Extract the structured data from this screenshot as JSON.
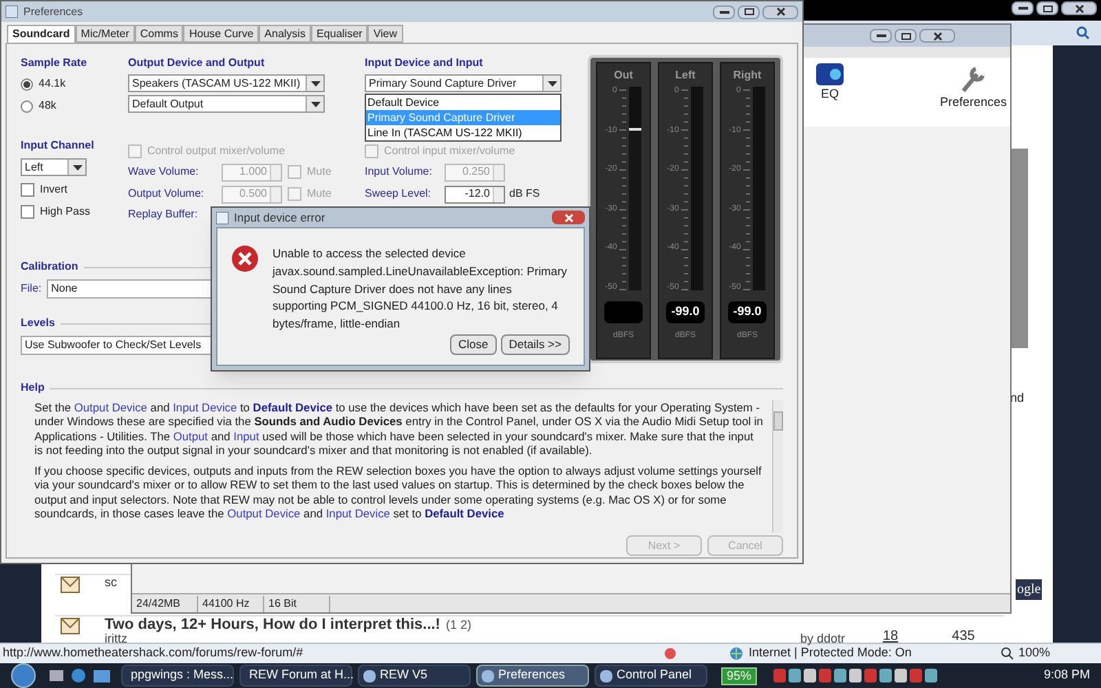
{
  "browser": {
    "forum_rows": [
      {
        "title": "sc"
      },
      {
        "title": "Two days, 12+ Hours, How do I interpret this...!",
        "pages": "(1 2)",
        "author": "irittz",
        "last_post": "by ddotr",
        "replies": "18",
        "views": "435"
      }
    ],
    "side_text": "nd",
    "logo_text": "ogle",
    "status": {
      "url": "http://www.hometheatershack.com/forums/rew-forum/#",
      "zone": "Internet | Protected Mode: On",
      "zoom": "100%"
    }
  },
  "rew_window": {
    "toolbar": [
      {
        "label": "EQ",
        "kind": "eq"
      },
      {
        "label": "Preferences",
        "kind": "wrench"
      }
    ],
    "status": [
      "24/42MB",
      "44100 Hz",
      "16 Bit"
    ]
  },
  "preferences": {
    "title": "Preferences",
    "tabs": [
      {
        "label": "Soundcard",
        "selected": true
      },
      {
        "label": "Mic/Meter",
        "selected": false
      },
      {
        "label": "Comms",
        "selected": false
      },
      {
        "label": "House Curve",
        "selected": false
      },
      {
        "label": "Analysis",
        "selected": false
      },
      {
        "label": "Equaliser",
        "selected": false
      },
      {
        "label": "View",
        "selected": false
      }
    ],
    "sample_rate": {
      "label": "Sample Rate",
      "options": [
        {
          "label": "44.1k",
          "selected": true
        },
        {
          "label": "48k",
          "selected": false
        }
      ]
    },
    "output": {
      "label": "Output Device and Output",
      "device": "Speakers (TASCAM US-122 MKII)",
      "output": "Default Output"
    },
    "input": {
      "label": "Input Device and Input",
      "device": "Primary Sound Capture Driver",
      "list": [
        {
          "label": "Default Device",
          "selected": false
        },
        {
          "label": "Primary Sound Capture Driver",
          "selected": true
        },
        {
          "label": "Line In (TASCAM US-122 MKII)",
          "selected": false
        }
      ]
    },
    "input_channel": {
      "label": "Input Channel",
      "value": "Left",
      "options": [
        {
          "label": "Invert",
          "checked": false
        },
        {
          "label": "High Pass",
          "checked": false
        }
      ]
    },
    "output_controls": {
      "control": {
        "label": "Control output mixer/volume",
        "checked": false
      },
      "rows": [
        {
          "label": "Wave Volume:",
          "value": "1.000",
          "disabled": true,
          "mute": "Mute",
          "muted": false
        },
        {
          "label": "Output Volume:",
          "value": "0.500",
          "disabled": true,
          "mute": "Mute",
          "muted": false
        }
      ],
      "replay_label": "Replay Buffer:"
    },
    "input_controls": {
      "control": {
        "label": "Control input mixer/volume",
        "checked": false
      },
      "rows": [
        {
          "label": "Input Volume:",
          "value": "0.250",
          "disabled": true
        },
        {
          "label": "Sweep Level:",
          "value": "-12.0",
          "disabled": false,
          "unit": "dB FS"
        }
      ]
    },
    "calibration": {
      "label": "Calibration",
      "file_label": "File:",
      "file": "None"
    },
    "levels": {
      "label": "Levels",
      "value": "Use Subwoofer to Check/Set Levels"
    },
    "help": {
      "label": "Help",
      "paragraphs": [
        [
          {
            "kind": "text",
            "text": "Set the "
          },
          {
            "kind": "link",
            "text": "Output Device"
          },
          {
            "kind": "text",
            "text": " and "
          },
          {
            "kind": "link",
            "text": "Input Device"
          },
          {
            "kind": "text",
            "text": " to "
          },
          {
            "kind": "bold-link",
            "text": "Default Device"
          },
          {
            "kind": "text",
            "text": " to use the devices which have been set as the defaults for your Operating System - under Windows these are specified via the "
          },
          {
            "kind": "bold",
            "text": "Sounds and Audio Devices"
          },
          {
            "kind": "text",
            "text": " entry in the Control Panel, under OS X via the Audio Midi Setup tool in Applications - Utilities. The "
          },
          {
            "kind": "link",
            "text": "Output"
          },
          {
            "kind": "text",
            "text": " and "
          },
          {
            "kind": "link",
            "text": "Input"
          },
          {
            "kind": "text",
            "text": " used will be those which have been selected in your soundcard's mixer. Make sure that the input is not feeding into the output signal in your soundcard's mixer and that monitoring is not enabled (if available)."
          }
        ],
        [
          {
            "kind": "text",
            "text": "If you choose specific devices, outputs and inputs from the REW selection boxes you have the option to always adjust volume settings yourself via your soundcard's mixer or to allow REW to set them to the last used values on startup. This is determined by the check boxes below the output and input selectors. Note that REW may not be able to control levels under some operating systems (e.g. Mac OS X) or for some soundcards, in those cases leave the "
          },
          {
            "kind": "link",
            "text": "Output Device"
          },
          {
            "kind": "text",
            "text": " and "
          },
          {
            "kind": "link",
            "text": "Input Device"
          },
          {
            "kind": "text",
            "text": " set to "
          },
          {
            "kind": "bold-link",
            "text": "Default Device"
          }
        ]
      ]
    },
    "buttons": [
      {
        "label": "Next >",
        "disabled": true
      },
      {
        "label": "Cancel",
        "disabled": true
      }
    ],
    "meters": [
      {
        "label": "Out",
        "scale": [
          "0",
          "-10",
          "-20",
          "-30",
          "-40",
          "-50"
        ],
        "unit": "dBFS",
        "level": 0.8
      },
      {
        "label": "Left",
        "scale": [
          "0",
          "-10",
          "-20",
          "-30",
          "-40",
          "-50"
        ],
        "reading": "-99.0",
        "unit": "dBFS"
      },
      {
        "label": "Right",
        "scale": [
          "0",
          "-10",
          "-20",
          "-30",
          "-40",
          "-50"
        ],
        "reading": "-99.0",
        "unit": "dBFS"
      }
    ]
  },
  "error_dialog": {
    "title": "Input device error",
    "message": [
      "Unable to access the selected device",
      "javax.sound.sampled.LineUnavailableException: Primary Sound Capture Driver does not have any lines supporting PCM_SIGNED 44100.0 Hz, 16 bit, stereo, 4 bytes/frame, little-endian"
    ],
    "buttons": [
      "Close",
      "Details >>"
    ]
  },
  "taskbar": {
    "items": [
      {
        "label": "ppgwings : Mess...",
        "selected": false
      },
      {
        "label": "REW Forum at H...",
        "selected": false
      },
      {
        "label": "REW V5",
        "selected": false
      },
      {
        "label": "Preferences",
        "selected": true
      },
      {
        "label": "Control Panel",
        "selected": false
      }
    ],
    "battery": "95%",
    "time": "9:08 PM"
  }
}
